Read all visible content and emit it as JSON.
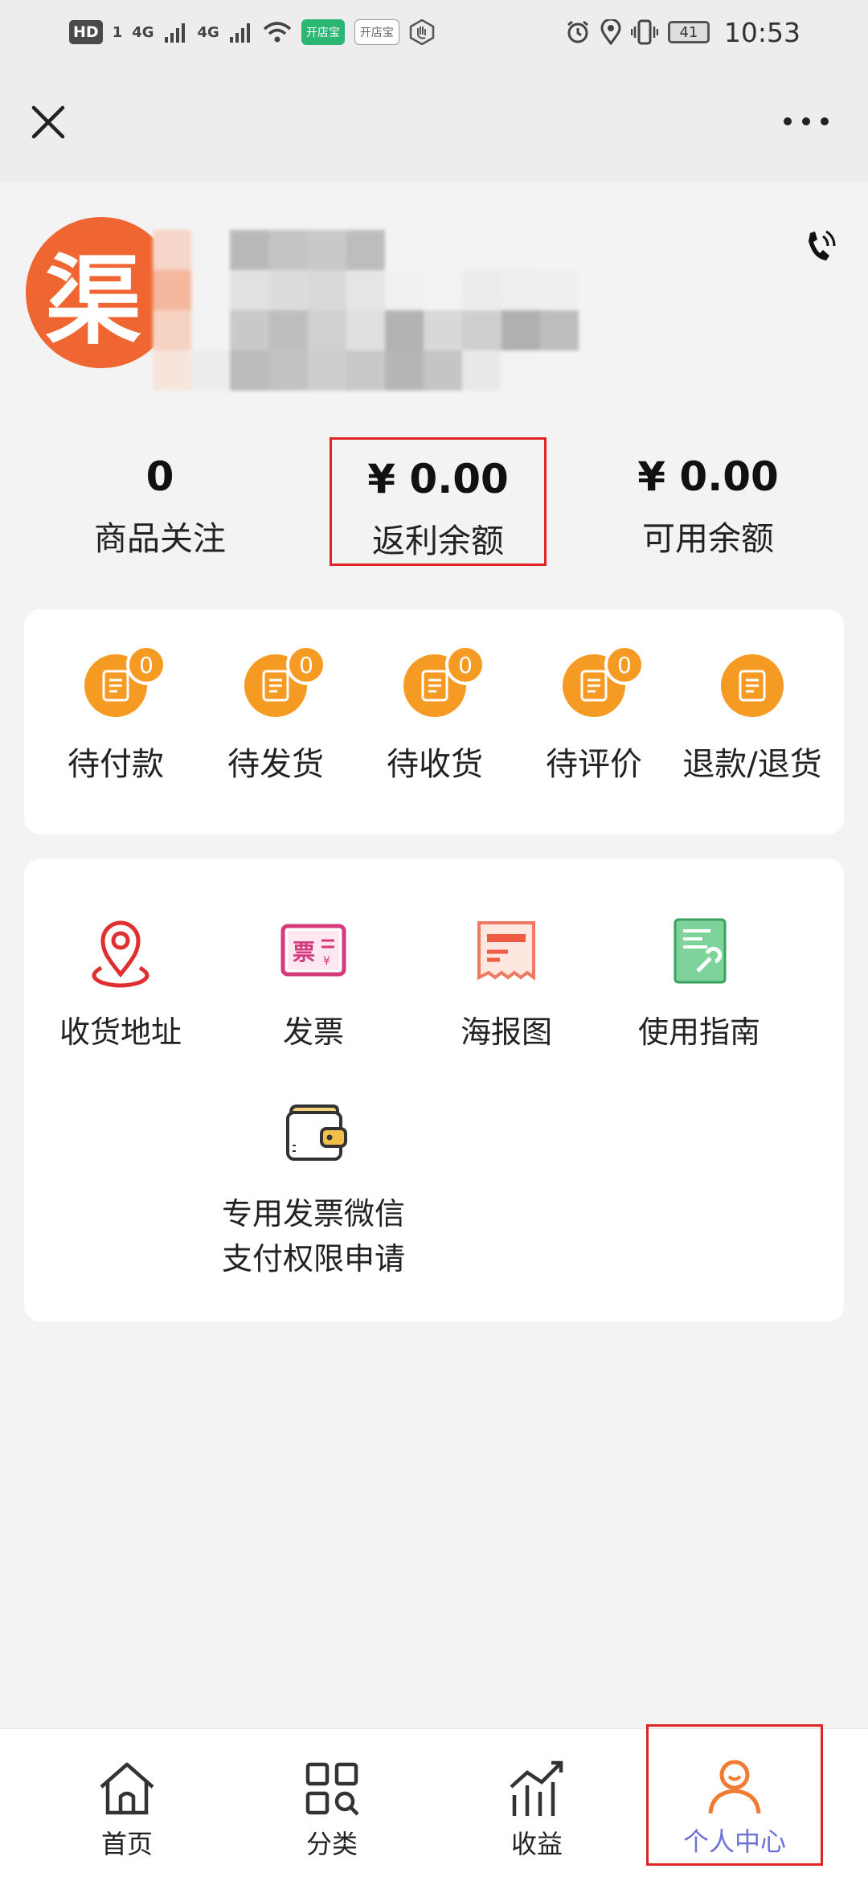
{
  "status_bar": {
    "hd": "HD",
    "sim": "1",
    "net1": "4G",
    "net2": "4G",
    "app_badge1": "开店宝",
    "app_badge2": "开店宝",
    "battery": "41",
    "time": "10:53"
  },
  "profile": {
    "avatar_char": "渠"
  },
  "stats": [
    {
      "value": "0",
      "label": "商品关注"
    },
    {
      "value": "¥ 0.00",
      "label": "返利余额"
    },
    {
      "value": "¥ 0.00",
      "label": "可用余额"
    }
  ],
  "orders": [
    {
      "label": "待付款",
      "badge": "0"
    },
    {
      "label": "待发货",
      "badge": "0"
    },
    {
      "label": "待收货",
      "badge": "0"
    },
    {
      "label": "待评价",
      "badge": "0"
    },
    {
      "label": "退款/退货"
    }
  ],
  "services": [
    {
      "label": "收货地址",
      "icon": "location-pin-icon"
    },
    {
      "label": "发票",
      "icon": "invoice-icon"
    },
    {
      "label": "海报图",
      "icon": "poster-icon"
    },
    {
      "label": "使用指南",
      "icon": "guide-icon"
    },
    {
      "label_line1": "专用发票微信",
      "label_line2": "支付权限申请",
      "icon": "wallet-icon"
    }
  ],
  "tabs": [
    {
      "label": "首页",
      "icon": "home-icon"
    },
    {
      "label": "分类",
      "icon": "category-icon"
    },
    {
      "label": "收益",
      "icon": "earnings-icon"
    },
    {
      "label": "个人中心",
      "icon": "user-icon",
      "active": true
    }
  ],
  "colors": {
    "accent_orange": "#f59a23",
    "avatar_orange": "#f06633",
    "active_tab": "#6e73d6",
    "highlight_border": "#e02323"
  }
}
